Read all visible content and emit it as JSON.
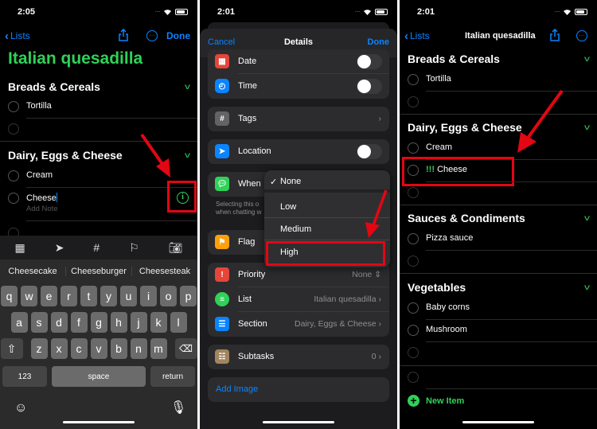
{
  "panel1": {
    "status_time": "2:05",
    "nav": {
      "back_label": "Lists",
      "done_label": "Done"
    },
    "title": "Italian quesadilla",
    "sections": [
      {
        "name": "Breads & Cereals",
        "items": [
          "Tortilla"
        ]
      },
      {
        "name": "Dairy, Eggs & Cheese",
        "items": [
          "Cream",
          "Cheese"
        ]
      }
    ],
    "editing_item": {
      "text": "Cheese",
      "note_placeholder": "Add Note"
    },
    "suggestions": [
      "Cheesecake",
      "Cheeseburger",
      "Cheesesteak"
    ],
    "keyboard": {
      "row1": [
        "q",
        "w",
        "e",
        "r",
        "t",
        "y",
        "u",
        "i",
        "o",
        "p"
      ],
      "row2": [
        "a",
        "s",
        "d",
        "f",
        "g",
        "h",
        "j",
        "k",
        "l"
      ],
      "row3": [
        "z",
        "x",
        "c",
        "v",
        "b",
        "n",
        "m"
      ],
      "numbers_label": "123",
      "space_label": "space",
      "return_label": "return"
    }
  },
  "panel2": {
    "status_time": "2:01",
    "sheet": {
      "cancel_label": "Cancel",
      "title": "Details",
      "done_label": "Done"
    },
    "rows": {
      "date": "Date",
      "time": "Time",
      "tags": "Tags",
      "location": "Location",
      "when_messaging": "When",
      "hint_line1": "Selecting this o",
      "hint_line2": "when chatting w",
      "flag": "Flag",
      "priority": "Priority",
      "priority_value": "None",
      "list": "List",
      "list_value": "Italian quesadilla",
      "section": "Section",
      "section_value": "Dairy, Eggs & Cheese",
      "subtasks": "Subtasks",
      "subtasks_value": "0",
      "add_image": "Add Image"
    },
    "toggles": {
      "date": false,
      "time": false,
      "location": false,
      "flag": false
    },
    "priority_menu": {
      "options": [
        "None",
        "Low",
        "Medium",
        "High"
      ],
      "selected": "None",
      "highlighted": "High"
    }
  },
  "panel3": {
    "status_time": "2:01",
    "nav": {
      "back_label": "Lists",
      "title": "Italian quesadilla"
    },
    "sections": [
      {
        "name": "Breads & Cereals",
        "items": [
          "Tortilla"
        ]
      },
      {
        "name": "Dairy, Eggs & Cheese",
        "items": [
          "Cream",
          "Cheese"
        ]
      },
      {
        "name": "Sauces & Condiments",
        "items": [
          "Pizza sauce"
        ]
      },
      {
        "name": "Vegetables",
        "items": [
          "Baby corns",
          "Mushroom"
        ]
      }
    ],
    "priority_marker": "!!!",
    "new_item_label": "New Item"
  },
  "colors": {
    "accent_green": "#30d158",
    "accent_blue": "#0a84ff",
    "annotation_red": "#e30613"
  }
}
